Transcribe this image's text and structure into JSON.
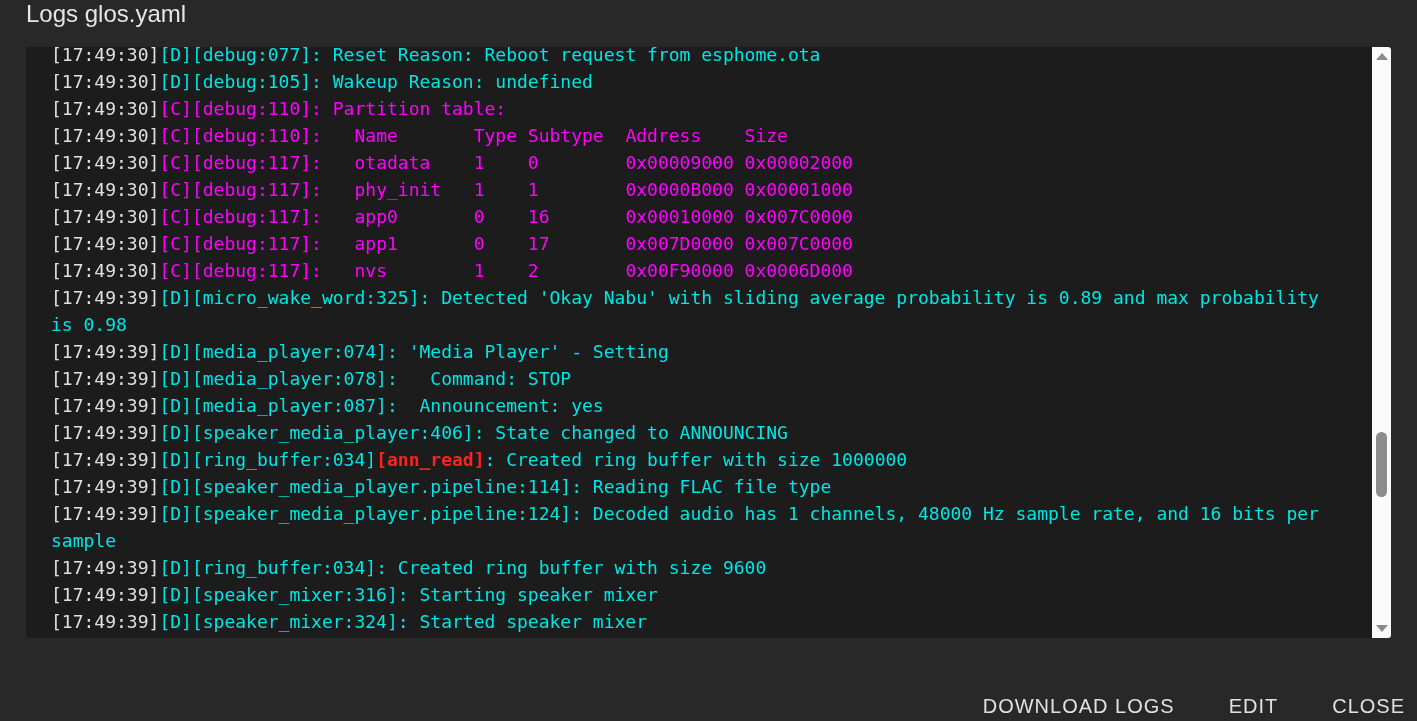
{
  "dialog": {
    "title": "Logs glos.yaml"
  },
  "log_lines": [
    {
      "time": "[17:49:30]",
      "level": "[D]",
      "tag": "[debug:077]",
      "message": ": Reset Reason: Reboot request from esphome.ota"
    },
    {
      "time": "[17:49:30]",
      "level": "[D]",
      "tag": "[debug:105]",
      "message": ": Wakeup Reason: undefined"
    },
    {
      "time": "[17:49:30]",
      "level": "[C]",
      "tag": "[debug:110]",
      "message": ": Partition table:"
    },
    {
      "time": "[17:49:30]",
      "level": "[C]",
      "tag": "[debug:110]",
      "message": ":   Name       Type Subtype  Address    Size"
    },
    {
      "time": "[17:49:30]",
      "level": "[C]",
      "tag": "[debug:117]",
      "message": ":   otadata    1    0        0x00009000 0x00002000"
    },
    {
      "time": "[17:49:30]",
      "level": "[C]",
      "tag": "[debug:117]",
      "message": ":   phy_init   1    1        0x0000B000 0x00001000"
    },
    {
      "time": "[17:49:30]",
      "level": "[C]",
      "tag": "[debug:117]",
      "message": ":   app0       0    16       0x00010000 0x007C0000"
    },
    {
      "time": "[17:49:30]",
      "level": "[C]",
      "tag": "[debug:117]",
      "message": ":   app1       0    17       0x007D0000 0x007C0000"
    },
    {
      "time": "[17:49:30]",
      "level": "[C]",
      "tag": "[debug:117]",
      "message": ":   nvs        1    2        0x00F90000 0x0006D000"
    },
    {
      "time": "[17:49:39]",
      "level": "[D]",
      "tag": "[micro_wake_word:325]",
      "message": ": Detected 'Okay Nabu' with sliding average probability is 0.89 and max probability is 0.98"
    },
    {
      "time": "[17:49:39]",
      "level": "[D]",
      "tag": "[media_player:074]",
      "message": ": 'Media Player' - Setting"
    },
    {
      "time": "[17:49:39]",
      "level": "[D]",
      "tag": "[media_player:078]",
      "message": ":   Command: STOP"
    },
    {
      "time": "[17:49:39]",
      "level": "[D]",
      "tag": "[media_player:087]",
      "message": ":  Announcement: yes"
    },
    {
      "time": "[17:49:39]",
      "level": "[D]",
      "tag": "[speaker_media_player:406]",
      "message": ": State changed to ANNOUNCING"
    },
    {
      "time": "[17:49:39]",
      "level": "[D]",
      "tag": "[ring_buffer:034]",
      "context": "[ann_read]",
      "message": ": Created ring buffer with size 1000000"
    },
    {
      "time": "[17:49:39]",
      "level": "[D]",
      "tag": "[speaker_media_player.pipeline:114]",
      "message": ": Reading FLAC file type"
    },
    {
      "time": "[17:49:39]",
      "level": "[D]",
      "tag": "[speaker_media_player.pipeline:124]",
      "message": ": Decoded audio has 1 channels, 48000 Hz sample rate, and 16 bits per sample"
    },
    {
      "time": "[17:49:39]",
      "level": "[D]",
      "tag": "[ring_buffer:034]",
      "message": ": Created ring buffer with size 9600"
    },
    {
      "time": "[17:49:39]",
      "level": "[D]",
      "tag": "[speaker_mixer:316]",
      "message": ": Starting speaker mixer"
    },
    {
      "time": "[17:49:39]",
      "level": "[D]",
      "tag": "[speaker_mixer:324]",
      "message": ": Started speaker mixer"
    }
  ],
  "buttons": [
    {
      "label": "DOWNLOAD LOGS"
    },
    {
      "label": "EDIT"
    },
    {
      "label": "CLOSE"
    }
  ]
}
